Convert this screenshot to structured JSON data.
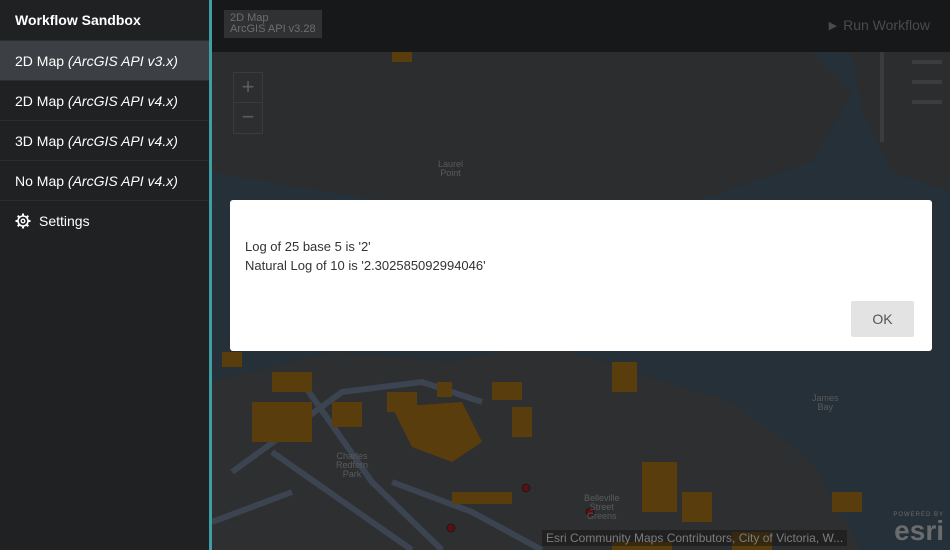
{
  "sidebar": {
    "title": "Workflow Sandbox",
    "items": [
      {
        "label": "2D Map ",
        "api": "(ArcGIS API v3.x)"
      },
      {
        "label": "2D Map ",
        "api": "(ArcGIS API v4.x)"
      },
      {
        "label": "3D Map ",
        "api": "(ArcGIS API v4.x)"
      },
      {
        "label": "No Map ",
        "api": "(ArcGIS API v4.x)"
      }
    ],
    "settings_label": "Settings"
  },
  "header": {
    "badge_line1": "2D Map",
    "badge_line2": "ArcGIS API v3.28",
    "run_label": "Run Workflow"
  },
  "map": {
    "zoom_in": "+",
    "zoom_out": "−",
    "labels": {
      "laurel": "Laurel\nPoint",
      "charles": "Charles\nRedfern\nPark",
      "bay": "James\nBay",
      "street": "Belleville\nStreet\nGreens"
    },
    "attribution": "Esri Community Maps Contributors, City of Victoria, W...",
    "logo_powered": "POWERED BY",
    "logo_word": "esri"
  },
  "dialog": {
    "line1": "Log of 25 base 5 is '2'",
    "line2": "Natural Log of 10 is '2.302585092994046'",
    "ok_label": "OK"
  }
}
